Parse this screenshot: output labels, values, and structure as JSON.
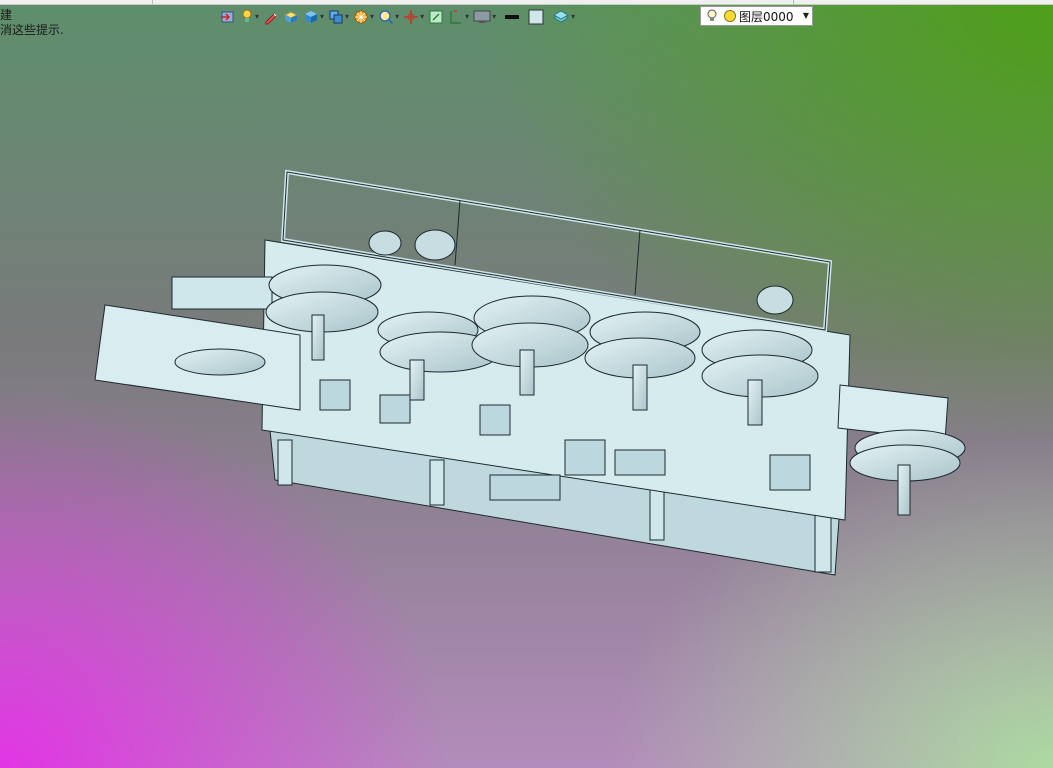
{
  "hint": {
    "line1": "建",
    "line2": "消这些提示."
  },
  "toolbar": {
    "items": [
      {
        "icon": "import-icon",
        "dropdown": false
      },
      {
        "icon": "lightbulb-pointer-icon",
        "dropdown": true
      },
      {
        "icon": "pen-tool-icon",
        "dropdown": false
      },
      {
        "icon": "solid-box-yellow-icon",
        "dropdown": false
      },
      {
        "icon": "cube-icon",
        "dropdown": true
      },
      {
        "icon": "view-orientation-icon",
        "dropdown": true
      },
      {
        "icon": "render-style-icon",
        "dropdown": true
      },
      {
        "icon": "zoom-icon",
        "dropdown": true
      },
      {
        "icon": "origin-axes-icon",
        "dropdown": true
      },
      {
        "icon": "section-view-icon",
        "dropdown": false
      },
      {
        "icon": "dimension-icon",
        "dropdown": true
      },
      {
        "icon": "display-monitor-icon",
        "dropdown": true
      },
      {
        "icon": "line-weight-icon",
        "dropdown": false
      },
      {
        "icon": "color-swatch-icon",
        "dropdown": false
      },
      {
        "icon": "layer-manager-icon",
        "dropdown": true
      }
    ],
    "layer": {
      "value": "图层0000",
      "icons": [
        "lightbulb-icon",
        "sun-icon"
      ]
    }
  },
  "colors": {
    "accent": "#cfe6ea",
    "line": "#1d2a30"
  }
}
